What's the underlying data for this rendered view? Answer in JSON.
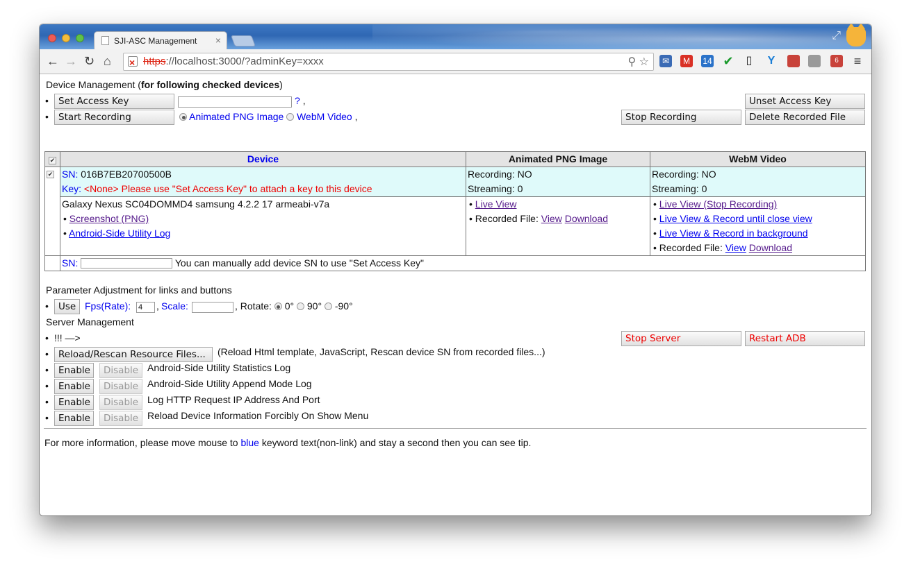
{
  "browser": {
    "tab_title": "SJI-ASC Management",
    "url_scheme": "https",
    "url_rest": "://localhost:3000/?adminKey=xxxx",
    "host_part": "localhost",
    "ext_badge_1": "14",
    "ext_badge_2": "6"
  },
  "device_mgmt": {
    "heading_prefix": "Device Management (",
    "heading_bold": "for following checked devices",
    "heading_suffix": ")",
    "set_access_key": "Set Access Key",
    "help_mark": "?",
    "comma": ",",
    "start_recording": "Start Recording",
    "animated_png": "Animated PNG Image",
    "webm": "WebM Video",
    "stop_recording": "Stop Recording",
    "unset_access_key": "Unset Access Key",
    "delete_recorded": "Delete Recorded File"
  },
  "table": {
    "headers": [
      "Device",
      "Animated PNG Image",
      "WebM Video"
    ],
    "device": {
      "sn_label": "SN:",
      "sn_value": "016B7EB20700500B",
      "key_label": "Key:",
      "key_text": "<None> Please use \"Set Access Key\" to attach a key to this device",
      "model": "Galaxy Nexus SC04DOMMD4 samsung 4.2.2 17 armeabi-v7a",
      "screenshot_link": "Screenshot (PNG)",
      "log_link": "Android-Side Utility Log"
    },
    "png": {
      "recording": "Recording: NO",
      "streaming": "Streaming: 0",
      "live_view": "Live View",
      "recorded_file": "Recorded File:",
      "view": "View",
      "download": "Download"
    },
    "webm": {
      "recording": "Recording: NO",
      "streaming": "Streaming: 0",
      "live_view_stop": "Live View (Stop Recording)",
      "live_view_record_close": "Live View & Record until close view",
      "live_view_record_bg": "Live View & Record in background",
      "recorded_file": "Recorded File:",
      "view": "View",
      "download": "Download"
    },
    "manual_sn_label": "SN:",
    "manual_sn_text": "You can manually add device SN to use \"Set Access Key\""
  },
  "params": {
    "heading": "Parameter Adjustment for links and buttons",
    "use": "Use",
    "fps_label": "Fps(Rate):",
    "fps_value": "4",
    "scale_label": "Scale:",
    "rotate_label": ", Rotate:",
    "rot_0": "0°",
    "rot_90": "90°",
    "rot_m90": "-90°"
  },
  "server": {
    "heading": "Server Management",
    "warn": "!!! —>",
    "stop_server": "Stop Server",
    "restart_adb": "Restart ADB",
    "reload": "Reload/Rescan Resource Files...",
    "reload_desc": "(Reload Html template, JavaScript, Rescan device SN from recorded files...)",
    "enable": "Enable",
    "disable": "Disable",
    "options": [
      "Android-Side Utility Statistics Log",
      "Android-Side Utility Append Mode Log",
      "Log HTTP Request IP Address And Port",
      "Reload Device Information Forcibly On Show Menu"
    ]
  },
  "footer": {
    "prefix": "For more information, please move mouse to ",
    "blue": "blue",
    "suffix": " keyword text(non-link) and stay a second then you can see tip."
  }
}
